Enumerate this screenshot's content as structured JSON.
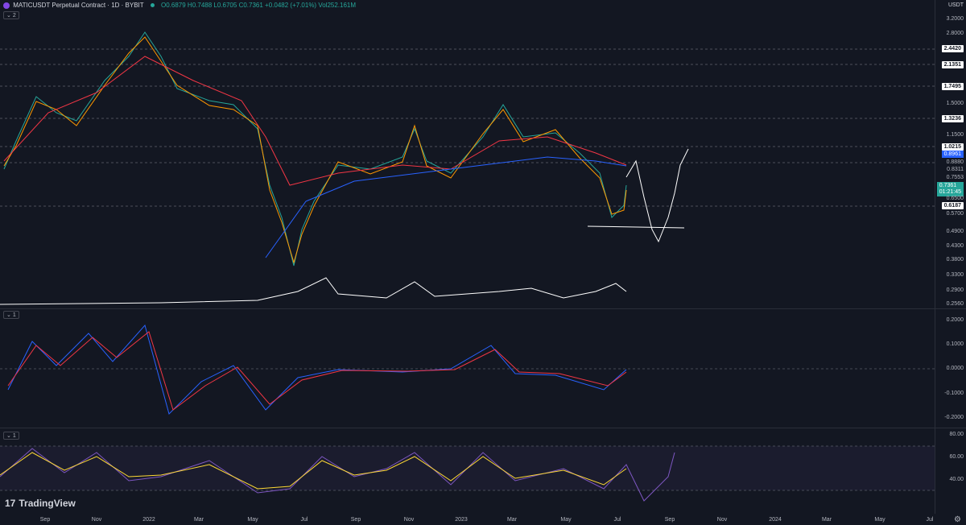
{
  "header": {
    "symbol": "MATICUSDT Perpetual Contract · 1D · BYBIT",
    "open": "O0.6879",
    "high": "H0.7488",
    "low": "L0.6705",
    "close": "C0.7361",
    "change": "+0.0482 (+7.01%)",
    "volume": "Vol252.161M"
  },
  "currency_button": "USDT",
  "brand": "TradingView",
  "pane_indicator_counts": [
    "2",
    "1",
    "1"
  ],
  "price_axis": [
    "3.2000",
    "2.8000",
    "2.4420",
    "2.1351",
    "1.7495",
    "1.5000",
    "1.3236",
    "1.1500",
    "1.0215",
    "0.8961",
    "0.8880",
    "0.8311",
    "0.7553",
    "0.7361",
    "01:21:45",
    "0.6500",
    "0.6187",
    "0.5700",
    "0.4900",
    "0.4300",
    "0.3800",
    "0.3300",
    "0.2900",
    "0.2560"
  ],
  "macd_axis": [
    "0.2000",
    "0.1000",
    "0.0000",
    "-0.1000",
    "-0.2000"
  ],
  "rsi_axis": [
    "80.00",
    "60.00",
    "40.00"
  ],
  "time_axis": [
    "Sep",
    "Nov",
    "2022",
    "Mar",
    "May",
    "Jul",
    "Sep",
    "Nov",
    "2023",
    "Mar",
    "May",
    "Jul",
    "Sep",
    "Nov",
    "2024",
    "Mar",
    "May",
    "Jul"
  ],
  "colors": {
    "background": "#131722",
    "up": "#26a69a",
    "down": "#ef5350",
    "blue_line": "#2962ff",
    "ma_orange": "#ff9800",
    "ma_red": "#f23645",
    "rsi_purple": "#7e57c2",
    "rsi_signal": "#fdd835"
  }
}
